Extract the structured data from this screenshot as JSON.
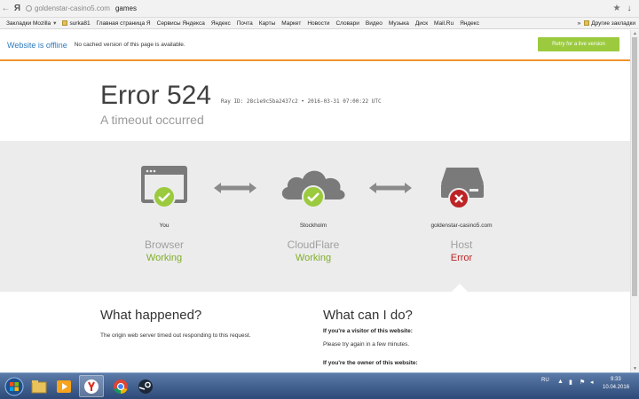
{
  "browser": {
    "url_host": "goldenstar-casino5.com",
    "url_query": "games",
    "bookmarks": [
      "Закладки Mozilla",
      "surka81",
      "Главная страница Я",
      "Сервисы Яндекса",
      "Яндекс",
      "Почта",
      "Карты",
      "Маркет",
      "Новости",
      "Словари",
      "Видео",
      "Музыка",
      "Диск",
      "Mail.Ru",
      "Яндекс"
    ],
    "other_bookmarks": "Другие закладки"
  },
  "banner": {
    "title": "Website is offline",
    "subtitle": "No cached version of this page is available.",
    "retry_label": "Retry for a live version",
    "accent": "#f0932d",
    "button_color": "#9bca3e"
  },
  "error": {
    "title": "Error 524",
    "ray": "Ray ID: 28c1e9c5ba2437c2 • 2016-03-31 07:00:22 UTC",
    "subtitle": "A timeout occurred"
  },
  "status": {
    "nodes": [
      {
        "location": "You",
        "role": "Browser",
        "state": "Working",
        "ok": true,
        "icon": "browser-window-icon"
      },
      {
        "location": "Stockholm",
        "role": "CloudFlare",
        "state": "Working",
        "ok": true,
        "icon": "cloud-icon"
      },
      {
        "location": "goldenstar-casino5.com",
        "role": "Host",
        "state": "Error",
        "ok": false,
        "icon": "server-icon"
      }
    ],
    "ok_color": "#7fae27",
    "error_color": "#bd2426"
  },
  "info": {
    "left_title": "What happened?",
    "left_text": "The origin web server timed out responding to this request.",
    "right_title": "What can I do?",
    "visitor_head": "If you're a visitor of this website:",
    "visitor_text": "Please try again in a few minutes.",
    "owner_head": "If you're the owner of this website:"
  },
  "taskbar": {
    "lang": "RU",
    "time": "9:33",
    "date": "10.04.2016"
  }
}
